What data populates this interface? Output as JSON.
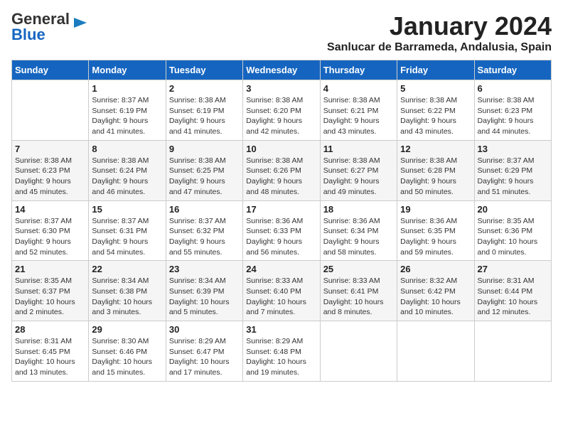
{
  "header": {
    "logo_general": "General",
    "logo_blue": "Blue",
    "month": "January 2024",
    "location": "Sanlucar de Barrameda, Andalusia, Spain"
  },
  "columns": [
    "Sunday",
    "Monday",
    "Tuesday",
    "Wednesday",
    "Thursday",
    "Friday",
    "Saturday"
  ],
  "weeks": [
    [
      {
        "day": "",
        "info": ""
      },
      {
        "day": "1",
        "info": "Sunrise: 8:37 AM\nSunset: 6:19 PM\nDaylight: 9 hours\nand 41 minutes."
      },
      {
        "day": "2",
        "info": "Sunrise: 8:38 AM\nSunset: 6:19 PM\nDaylight: 9 hours\nand 41 minutes."
      },
      {
        "day": "3",
        "info": "Sunrise: 8:38 AM\nSunset: 6:20 PM\nDaylight: 9 hours\nand 42 minutes."
      },
      {
        "day": "4",
        "info": "Sunrise: 8:38 AM\nSunset: 6:21 PM\nDaylight: 9 hours\nand 43 minutes."
      },
      {
        "day": "5",
        "info": "Sunrise: 8:38 AM\nSunset: 6:22 PM\nDaylight: 9 hours\nand 43 minutes."
      },
      {
        "day": "6",
        "info": "Sunrise: 8:38 AM\nSunset: 6:23 PM\nDaylight: 9 hours\nand 44 minutes."
      }
    ],
    [
      {
        "day": "7",
        "info": "Sunrise: 8:38 AM\nSunset: 6:23 PM\nDaylight: 9 hours\nand 45 minutes."
      },
      {
        "day": "8",
        "info": "Sunrise: 8:38 AM\nSunset: 6:24 PM\nDaylight: 9 hours\nand 46 minutes."
      },
      {
        "day": "9",
        "info": "Sunrise: 8:38 AM\nSunset: 6:25 PM\nDaylight: 9 hours\nand 47 minutes."
      },
      {
        "day": "10",
        "info": "Sunrise: 8:38 AM\nSunset: 6:26 PM\nDaylight: 9 hours\nand 48 minutes."
      },
      {
        "day": "11",
        "info": "Sunrise: 8:38 AM\nSunset: 6:27 PM\nDaylight: 9 hours\nand 49 minutes."
      },
      {
        "day": "12",
        "info": "Sunrise: 8:38 AM\nSunset: 6:28 PM\nDaylight: 9 hours\nand 50 minutes."
      },
      {
        "day": "13",
        "info": "Sunrise: 8:37 AM\nSunset: 6:29 PM\nDaylight: 9 hours\nand 51 minutes."
      }
    ],
    [
      {
        "day": "14",
        "info": "Sunrise: 8:37 AM\nSunset: 6:30 PM\nDaylight: 9 hours\nand 52 minutes."
      },
      {
        "day": "15",
        "info": "Sunrise: 8:37 AM\nSunset: 6:31 PM\nDaylight: 9 hours\nand 54 minutes."
      },
      {
        "day": "16",
        "info": "Sunrise: 8:37 AM\nSunset: 6:32 PM\nDaylight: 9 hours\nand 55 minutes."
      },
      {
        "day": "17",
        "info": "Sunrise: 8:36 AM\nSunset: 6:33 PM\nDaylight: 9 hours\nand 56 minutes."
      },
      {
        "day": "18",
        "info": "Sunrise: 8:36 AM\nSunset: 6:34 PM\nDaylight: 9 hours\nand 58 minutes."
      },
      {
        "day": "19",
        "info": "Sunrise: 8:36 AM\nSunset: 6:35 PM\nDaylight: 9 hours\nand 59 minutes."
      },
      {
        "day": "20",
        "info": "Sunrise: 8:35 AM\nSunset: 6:36 PM\nDaylight: 10 hours\nand 0 minutes."
      }
    ],
    [
      {
        "day": "21",
        "info": "Sunrise: 8:35 AM\nSunset: 6:37 PM\nDaylight: 10 hours\nand 2 minutes."
      },
      {
        "day": "22",
        "info": "Sunrise: 8:34 AM\nSunset: 6:38 PM\nDaylight: 10 hours\nand 3 minutes."
      },
      {
        "day": "23",
        "info": "Sunrise: 8:34 AM\nSunset: 6:39 PM\nDaylight: 10 hours\nand 5 minutes."
      },
      {
        "day": "24",
        "info": "Sunrise: 8:33 AM\nSunset: 6:40 PM\nDaylight: 10 hours\nand 7 minutes."
      },
      {
        "day": "25",
        "info": "Sunrise: 8:33 AM\nSunset: 6:41 PM\nDaylight: 10 hours\nand 8 minutes."
      },
      {
        "day": "26",
        "info": "Sunrise: 8:32 AM\nSunset: 6:42 PM\nDaylight: 10 hours\nand 10 minutes."
      },
      {
        "day": "27",
        "info": "Sunrise: 8:31 AM\nSunset: 6:44 PM\nDaylight: 10 hours\nand 12 minutes."
      }
    ],
    [
      {
        "day": "28",
        "info": "Sunrise: 8:31 AM\nSunset: 6:45 PM\nDaylight: 10 hours\nand 13 minutes."
      },
      {
        "day": "29",
        "info": "Sunrise: 8:30 AM\nSunset: 6:46 PM\nDaylight: 10 hours\nand 15 minutes."
      },
      {
        "day": "30",
        "info": "Sunrise: 8:29 AM\nSunset: 6:47 PM\nDaylight: 10 hours\nand 17 minutes."
      },
      {
        "day": "31",
        "info": "Sunrise: 8:29 AM\nSunset: 6:48 PM\nDaylight: 10 hours\nand 19 minutes."
      },
      {
        "day": "",
        "info": ""
      },
      {
        "day": "",
        "info": ""
      },
      {
        "day": "",
        "info": ""
      }
    ]
  ]
}
